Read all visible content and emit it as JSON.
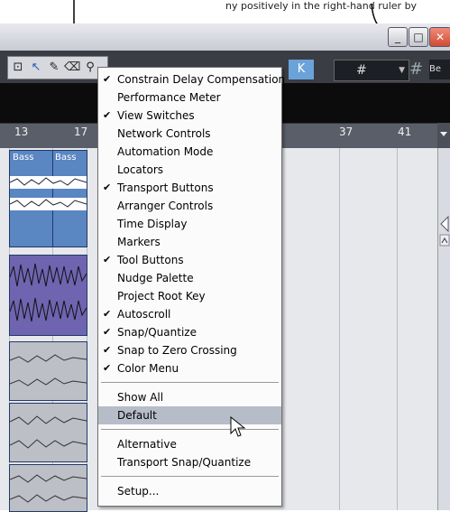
{
  "caption": {
    "text": "ny positively in the right-hand ruler by"
  },
  "window": {
    "minimize_glyph": "_",
    "maximize_glyph": "□",
    "close_glyph": "✕"
  },
  "toolbar": {
    "snap_glyph": "#",
    "grid_glyph": "#",
    "be_label": "Be",
    "k_glyph": "K"
  },
  "ruler": {
    "ticks": [
      "13",
      "17",
      "37",
      "41"
    ]
  },
  "clips": {
    "bass_label_1": "Bass",
    "bass_label_2": "Bass"
  },
  "menu": {
    "items": [
      {
        "label": "Constrain Delay Compensation",
        "checked": true
      },
      {
        "label": "Performance Meter",
        "checked": false
      },
      {
        "label": "View Switches",
        "checked": true
      },
      {
        "label": "Network Controls",
        "checked": false
      },
      {
        "label": "Automation Mode",
        "checked": false
      },
      {
        "label": "Locators",
        "checked": false
      },
      {
        "label": "Transport Buttons",
        "checked": true
      },
      {
        "label": "Arranger Controls",
        "checked": false
      },
      {
        "label": "Time Display",
        "checked": false
      },
      {
        "label": "Markers",
        "checked": false
      },
      {
        "label": "Tool Buttons",
        "checked": true
      },
      {
        "label": "Nudge Palette",
        "checked": false
      },
      {
        "label": "Project Root Key",
        "checked": false
      },
      {
        "label": "Autoscroll",
        "checked": true
      },
      {
        "label": "Snap/Quantize",
        "checked": true
      },
      {
        "label": "Snap to Zero Crossing",
        "checked": true
      },
      {
        "label": "Color Menu",
        "checked": true
      }
    ],
    "show_all": "Show All",
    "default": "Default",
    "alternative": "Alternative",
    "transport_snap": "Transport  Snap/Quantize",
    "setup": "Setup...",
    "check_glyph": "✔"
  },
  "colors": {
    "menu_highlight": "#b7bcc9",
    "clip_blue": "#5a86c2",
    "clip_purple": "#6f64b0",
    "clip_gray": "#b9bcc4"
  }
}
